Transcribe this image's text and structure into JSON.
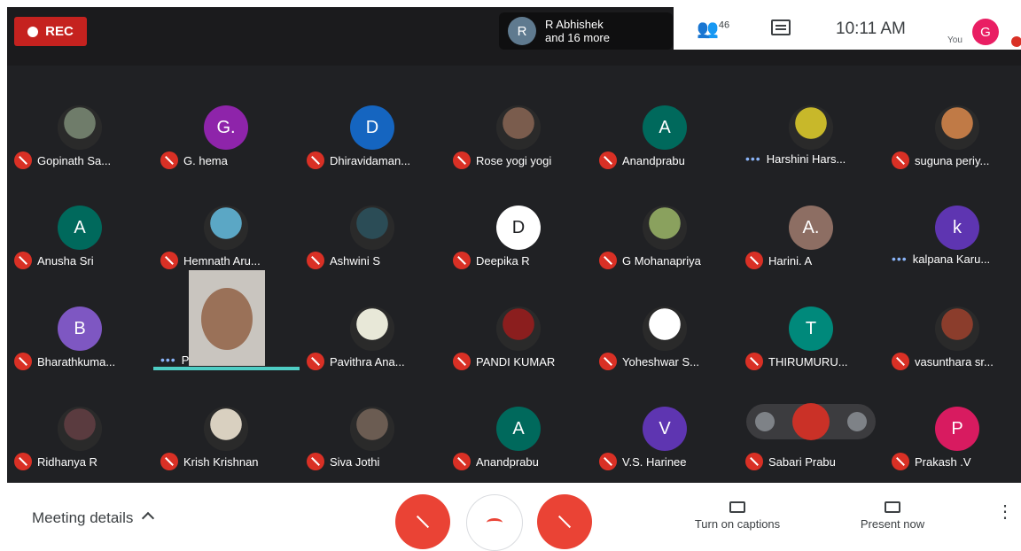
{
  "recording": {
    "label": "REC"
  },
  "speaker": {
    "avatar_letter": "R",
    "line1": "R Abhishek",
    "line2": "and 16 more"
  },
  "topbar": {
    "people_count": "46",
    "time": "10:11 AM",
    "you_label": "You",
    "self_avatar_letter": "G"
  },
  "participants": [
    {
      "name": "Gopinath Sa...",
      "avatar": "photo",
      "color": "#6f7c6a",
      "status": "muted"
    },
    {
      "name": "G. hema",
      "avatar": "G.",
      "color": "#8e24aa",
      "status": "muted"
    },
    {
      "name": "Dhiravidaman...",
      "avatar": "D",
      "color": "#1565c0",
      "status": "muted"
    },
    {
      "name": "Rose yogi yogi",
      "avatar": "photo",
      "color": "#7a5c4d",
      "status": "muted"
    },
    {
      "name": "Anandprabu",
      "avatar": "A",
      "color": "#00695c",
      "status": "muted"
    },
    {
      "name": "Harshini Hars...",
      "avatar": "photo",
      "color": "#c8b82a",
      "status": "speaking"
    },
    {
      "name": "suguna periy...",
      "avatar": "photo",
      "color": "#c07a46",
      "status": "muted"
    },
    {
      "name": "Anusha Sri",
      "avatar": "A",
      "color": "#00695c",
      "status": "muted"
    },
    {
      "name": "Hemnath Aru...",
      "avatar": "photo",
      "color": "#5ba7c5",
      "status": "muted"
    },
    {
      "name": "Ashwini S",
      "avatar": "photo",
      "color": "#2b4c56",
      "status": "muted"
    },
    {
      "name": "Deepika R",
      "avatar": "D",
      "color": "#ffffff",
      "text_color": "#202124",
      "status": "muted"
    },
    {
      "name": "G Mohanapriya",
      "avatar": "photo",
      "color": "#8aa15e",
      "status": "muted"
    },
    {
      "name": "Harini. A",
      "avatar": "A.",
      "color": "#8d6e63",
      "status": "muted"
    },
    {
      "name": "kalpana Karu...",
      "avatar": "k",
      "color": "#5e35b1",
      "status": "speaking"
    },
    {
      "name": "Bharathkuma...",
      "avatar": "B",
      "color": "#7e57c2",
      "status": "muted"
    },
    {
      "name": "Praveen B",
      "avatar": "video",
      "color": "#c9c5bf",
      "status": "speaking"
    },
    {
      "name": "Pavithra Ana...",
      "avatar": "photo",
      "color": "#e8e8d8",
      "status": "muted"
    },
    {
      "name": "PANDI KUMAR",
      "avatar": "photo",
      "color": "#8b1e1e",
      "status": "muted"
    },
    {
      "name": "Yoheshwar S...",
      "avatar": "photo",
      "color": "#ffffff",
      "status": "muted"
    },
    {
      "name": "THIRUMURU...",
      "avatar": "T",
      "color": "#00897b",
      "status": "muted"
    },
    {
      "name": "vasunthara sr...",
      "avatar": "photo",
      "color": "#8b3d2c",
      "status": "muted"
    },
    {
      "name": "Ridhanya R",
      "avatar": "photo",
      "color": "#5a3b3f",
      "status": "muted"
    },
    {
      "name": "Krish Krishnan",
      "avatar": "photo",
      "color": "#d9d0c0",
      "status": "muted"
    },
    {
      "name": "Siva Jothi",
      "avatar": "photo",
      "color": "#6b5c52",
      "status": "muted"
    },
    {
      "name": "Anandprabu",
      "avatar": "A",
      "color": "#00695c",
      "status": "muted"
    },
    {
      "name": "V.S. Harinee",
      "avatar": "V",
      "color": "#5e35b1",
      "status": "muted"
    },
    {
      "name": "Sabari Prabu",
      "avatar": "none",
      "color": "#3c3c3f",
      "status": "muted"
    },
    {
      "name": "Prakash .V",
      "avatar": "P",
      "color": "#d81b60",
      "status": "muted"
    }
  ],
  "bottom": {
    "meeting_details": "Meeting details",
    "captions": "Turn on captions",
    "present": "Present now"
  }
}
